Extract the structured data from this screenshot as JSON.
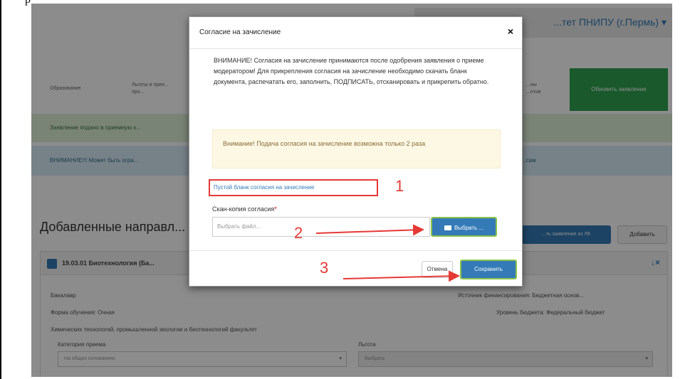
{
  "top_text": "p",
  "background": {
    "university": "...тет ПНИПУ (г.Пермь) ▾",
    "steps": [
      "Образование",
      "Льготы и преи...\nпро...",
      "...ны\n...нтов"
    ],
    "submit_button": "Обновить заявление",
    "alert_success": "Заявление подано в приемную к...",
    "alert_info": "ВНИМАНИЕ!!! Может быть огра...",
    "alert_info_right": "...сам",
    "section_title": "Добавленные направл...",
    "export_button": "...ть заявление из ЛК",
    "add_button": "Добавить",
    "panel": {
      "heading": "19.03.01 Биотехнология (Ба...",
      "row1_left": "Бакалавр",
      "row1_right": "Источник финансирования: Бюджетная основ...",
      "row2_left": "Форма обучения: Очная",
      "row2_right": "Уровень бюджета: Федеральный бюджет",
      "row3": "Химических технологий, промышленной экологии и биотехнологий факультет",
      "category_label": "Категория приема",
      "category_value": "На общих основаниях",
      "benefit_label": "Льгота",
      "benefit_value": "Выбрать"
    }
  },
  "modal": {
    "title": "Согласие на зачисление",
    "close": "×",
    "warning": "ВНИМАНИЕ! Согласия на зачисление принимаются после одобрения заявления о приеме модератором! Для прикрепления согласия на зачисление необходимо скачать бланк документа, распечатать его, заполнить, ПОДПИСАТЬ, отсканировать и прикрепить обратно.",
    "notice": "Внимание! Подача согласия на зачисление возможна только 2 раза",
    "blank_link": "Пустой бланк согласия на зачисление",
    "scan_label": "Скан-копия согласия",
    "required_mark": "*",
    "file_placeholder": "Выбрать файл...",
    "choose_button": "Выбрать ...",
    "cancel_button": "Отмена",
    "save_button": "Сохранить"
  },
  "annotations": [
    "1",
    "2",
    "3"
  ],
  "colors": {
    "primary": "#337ab7",
    "success_button": "#2ea34f",
    "annotation_red": "#e53935",
    "highlight_green": "#8bc34a"
  }
}
